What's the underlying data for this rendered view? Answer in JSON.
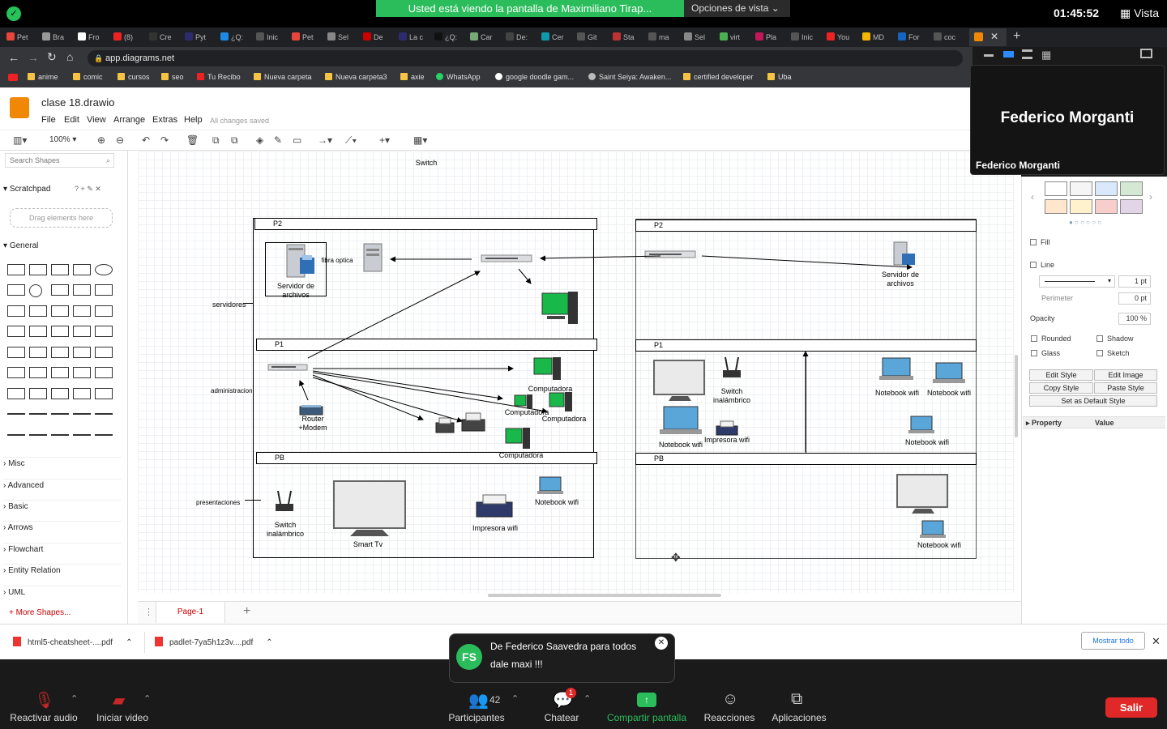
{
  "zoom": {
    "banner": "Usted está viendo la pantalla de Maximiliano Tirap...",
    "view_options": "Opciones de vista",
    "clock": "01:45:52",
    "vista": "Vista",
    "participant_name": "Federico Morganti",
    "participant_caption": "Federico Morganti",
    "controls": {
      "audio": "Reactivar audio",
      "video": "Iniciar video",
      "participants": "Participantes",
      "participants_count": "42",
      "chat": "Chatear",
      "chat_badge": "1",
      "share": "Compartir pantalla",
      "reactions": "Reacciones",
      "apps": "Aplicaciones",
      "leave": "Salir"
    },
    "chat_popup": {
      "initials": "FS",
      "from": "De Federico Saavedra para todos",
      "message": "dale maxi !!!"
    }
  },
  "browser": {
    "tabs": [
      "Pet",
      "Bra",
      "Fro",
      "(8)",
      "Cre",
      "Pyt",
      "¿Q:",
      "Inic",
      "Pet",
      "Sel",
      "De",
      "La c",
      "¿Q:",
      "Car",
      "De:",
      "Cer",
      "Git",
      "Sta",
      "ma",
      "Sel",
      "virt",
      "Pla",
      "Inic",
      "You",
      "MD",
      "For",
      "coc"
    ],
    "url": "app.diagrams.net",
    "bookmarks": [
      "anime",
      "comic",
      "cursos",
      "seo",
      "Tu Recibo",
      "Nueva carpeta",
      "Nueva carpeta3",
      "axie",
      "WhatsApp",
      "google doodle gam...",
      "Saint Seiya: Awaken...",
      "certified developer",
      "Uba"
    ],
    "downloads": [
      "html5-cheatsheet-....pdf",
      "padlet-7ya5h1z3v....pdf"
    ],
    "show_all": "Mostrar todo"
  },
  "app": {
    "file_title": "clase 18.drawio",
    "menus": [
      "File",
      "Edit",
      "View",
      "Arrange",
      "Extras",
      "Help"
    ],
    "saved_status": "All changes saved",
    "zoom_level": "100%",
    "search_placeholder": "Search Shapes",
    "scratchpad": "Scratchpad",
    "drag_here": "Drag elements here",
    "general": "General",
    "categories": [
      "Misc",
      "Advanced",
      "Basic",
      "Arrows",
      "Flowchart",
      "Entity Relation",
      "UML"
    ],
    "more_shapes": "More Shapes...",
    "page_tab": "Page-1"
  },
  "diagram": {
    "top_label": "Switch",
    "left": {
      "floors": [
        "P2",
        "P1",
        "PB"
      ],
      "side_labels": [
        "servidores",
        "administracion",
        "presentaciones"
      ],
      "fileserver": "Servidor de archivos",
      "fiber": "fibra optica",
      "router": "Router +Modem",
      "computers": [
        "Computadora",
        "Computadora",
        "Computadora",
        "Computadora"
      ],
      "switch_wifi": "Switch inalámbrico",
      "smart_tv": "Smart Tv",
      "printer_wifi": "Impresora wifi",
      "notebook_wifi": "Notebook wifi"
    },
    "right": {
      "floors": [
        "P2",
        "P1",
        "PB"
      ],
      "fileserver": "Servidor de archivos",
      "switch_wifi": "Switch inalámbrico",
      "printer_wifi": "Impresora wifi",
      "notebooks": [
        "Notebook wifi",
        "Notebook wifi",
        "Notebook wifi",
        "Notebook wifi",
        "Notebook wifi"
      ]
    }
  },
  "format_panel": {
    "fill": "Fill",
    "line": "Line",
    "line_width": "1 pt",
    "perimeter": "Perimeter",
    "perimeter_value": "0 pt",
    "opacity": "Opacity",
    "opacity_value": "100 %",
    "rounded": "Rounded",
    "shadow": "Shadow",
    "glass": "Glass",
    "sketch": "Sketch",
    "edit_style": "Edit Style",
    "edit_image": "Edit Image",
    "copy_style": "Copy Style",
    "paste_style": "Paste Style",
    "set_default": "Set as Default Style",
    "property": "Property",
    "value": "Value",
    "swatches": [
      "#ffffff",
      "#f5f5f5",
      "#dae8fc",
      "#d5e8d4",
      "#ffe6cc",
      "#fff2cc",
      "#f8cecc",
      "#e1d5e7"
    ]
  }
}
